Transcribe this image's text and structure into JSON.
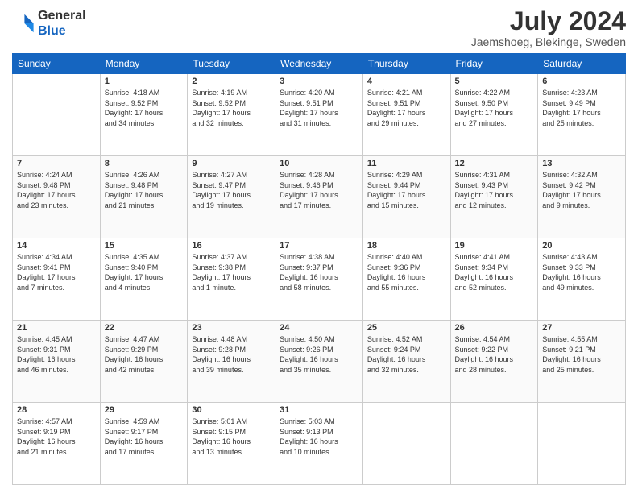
{
  "header": {
    "logo_general": "General",
    "logo_blue": "Blue",
    "month_title": "July 2024",
    "location": "Jaemshoeg, Blekinge, Sweden"
  },
  "days_of_week": [
    "Sunday",
    "Monday",
    "Tuesday",
    "Wednesday",
    "Thursday",
    "Friday",
    "Saturday"
  ],
  "weeks": [
    [
      {
        "day": "",
        "info": ""
      },
      {
        "day": "1",
        "info": "Sunrise: 4:18 AM\nSunset: 9:52 PM\nDaylight: 17 hours\nand 34 minutes."
      },
      {
        "day": "2",
        "info": "Sunrise: 4:19 AM\nSunset: 9:52 PM\nDaylight: 17 hours\nand 32 minutes."
      },
      {
        "day": "3",
        "info": "Sunrise: 4:20 AM\nSunset: 9:51 PM\nDaylight: 17 hours\nand 31 minutes."
      },
      {
        "day": "4",
        "info": "Sunrise: 4:21 AM\nSunset: 9:51 PM\nDaylight: 17 hours\nand 29 minutes."
      },
      {
        "day": "5",
        "info": "Sunrise: 4:22 AM\nSunset: 9:50 PM\nDaylight: 17 hours\nand 27 minutes."
      },
      {
        "day": "6",
        "info": "Sunrise: 4:23 AM\nSunset: 9:49 PM\nDaylight: 17 hours\nand 25 minutes."
      }
    ],
    [
      {
        "day": "7",
        "info": "Sunrise: 4:24 AM\nSunset: 9:48 PM\nDaylight: 17 hours\nand 23 minutes."
      },
      {
        "day": "8",
        "info": "Sunrise: 4:26 AM\nSunset: 9:48 PM\nDaylight: 17 hours\nand 21 minutes."
      },
      {
        "day": "9",
        "info": "Sunrise: 4:27 AM\nSunset: 9:47 PM\nDaylight: 17 hours\nand 19 minutes."
      },
      {
        "day": "10",
        "info": "Sunrise: 4:28 AM\nSunset: 9:46 PM\nDaylight: 17 hours\nand 17 minutes."
      },
      {
        "day": "11",
        "info": "Sunrise: 4:29 AM\nSunset: 9:44 PM\nDaylight: 17 hours\nand 15 minutes."
      },
      {
        "day": "12",
        "info": "Sunrise: 4:31 AM\nSunset: 9:43 PM\nDaylight: 17 hours\nand 12 minutes."
      },
      {
        "day": "13",
        "info": "Sunrise: 4:32 AM\nSunset: 9:42 PM\nDaylight: 17 hours\nand 9 minutes."
      }
    ],
    [
      {
        "day": "14",
        "info": "Sunrise: 4:34 AM\nSunset: 9:41 PM\nDaylight: 17 hours\nand 7 minutes."
      },
      {
        "day": "15",
        "info": "Sunrise: 4:35 AM\nSunset: 9:40 PM\nDaylight: 17 hours\nand 4 minutes."
      },
      {
        "day": "16",
        "info": "Sunrise: 4:37 AM\nSunset: 9:38 PM\nDaylight: 17 hours\nand 1 minute."
      },
      {
        "day": "17",
        "info": "Sunrise: 4:38 AM\nSunset: 9:37 PM\nDaylight: 16 hours\nand 58 minutes."
      },
      {
        "day": "18",
        "info": "Sunrise: 4:40 AM\nSunset: 9:36 PM\nDaylight: 16 hours\nand 55 minutes."
      },
      {
        "day": "19",
        "info": "Sunrise: 4:41 AM\nSunset: 9:34 PM\nDaylight: 16 hours\nand 52 minutes."
      },
      {
        "day": "20",
        "info": "Sunrise: 4:43 AM\nSunset: 9:33 PM\nDaylight: 16 hours\nand 49 minutes."
      }
    ],
    [
      {
        "day": "21",
        "info": "Sunrise: 4:45 AM\nSunset: 9:31 PM\nDaylight: 16 hours\nand 46 minutes."
      },
      {
        "day": "22",
        "info": "Sunrise: 4:47 AM\nSunset: 9:29 PM\nDaylight: 16 hours\nand 42 minutes."
      },
      {
        "day": "23",
        "info": "Sunrise: 4:48 AM\nSunset: 9:28 PM\nDaylight: 16 hours\nand 39 minutes."
      },
      {
        "day": "24",
        "info": "Sunrise: 4:50 AM\nSunset: 9:26 PM\nDaylight: 16 hours\nand 35 minutes."
      },
      {
        "day": "25",
        "info": "Sunrise: 4:52 AM\nSunset: 9:24 PM\nDaylight: 16 hours\nand 32 minutes."
      },
      {
        "day": "26",
        "info": "Sunrise: 4:54 AM\nSunset: 9:22 PM\nDaylight: 16 hours\nand 28 minutes."
      },
      {
        "day": "27",
        "info": "Sunrise: 4:55 AM\nSunset: 9:21 PM\nDaylight: 16 hours\nand 25 minutes."
      }
    ],
    [
      {
        "day": "28",
        "info": "Sunrise: 4:57 AM\nSunset: 9:19 PM\nDaylight: 16 hours\nand 21 minutes."
      },
      {
        "day": "29",
        "info": "Sunrise: 4:59 AM\nSunset: 9:17 PM\nDaylight: 16 hours\nand 17 minutes."
      },
      {
        "day": "30",
        "info": "Sunrise: 5:01 AM\nSunset: 9:15 PM\nDaylight: 16 hours\nand 13 minutes."
      },
      {
        "day": "31",
        "info": "Sunrise: 5:03 AM\nSunset: 9:13 PM\nDaylight: 16 hours\nand 10 minutes."
      },
      {
        "day": "",
        "info": ""
      },
      {
        "day": "",
        "info": ""
      },
      {
        "day": "",
        "info": ""
      }
    ]
  ]
}
